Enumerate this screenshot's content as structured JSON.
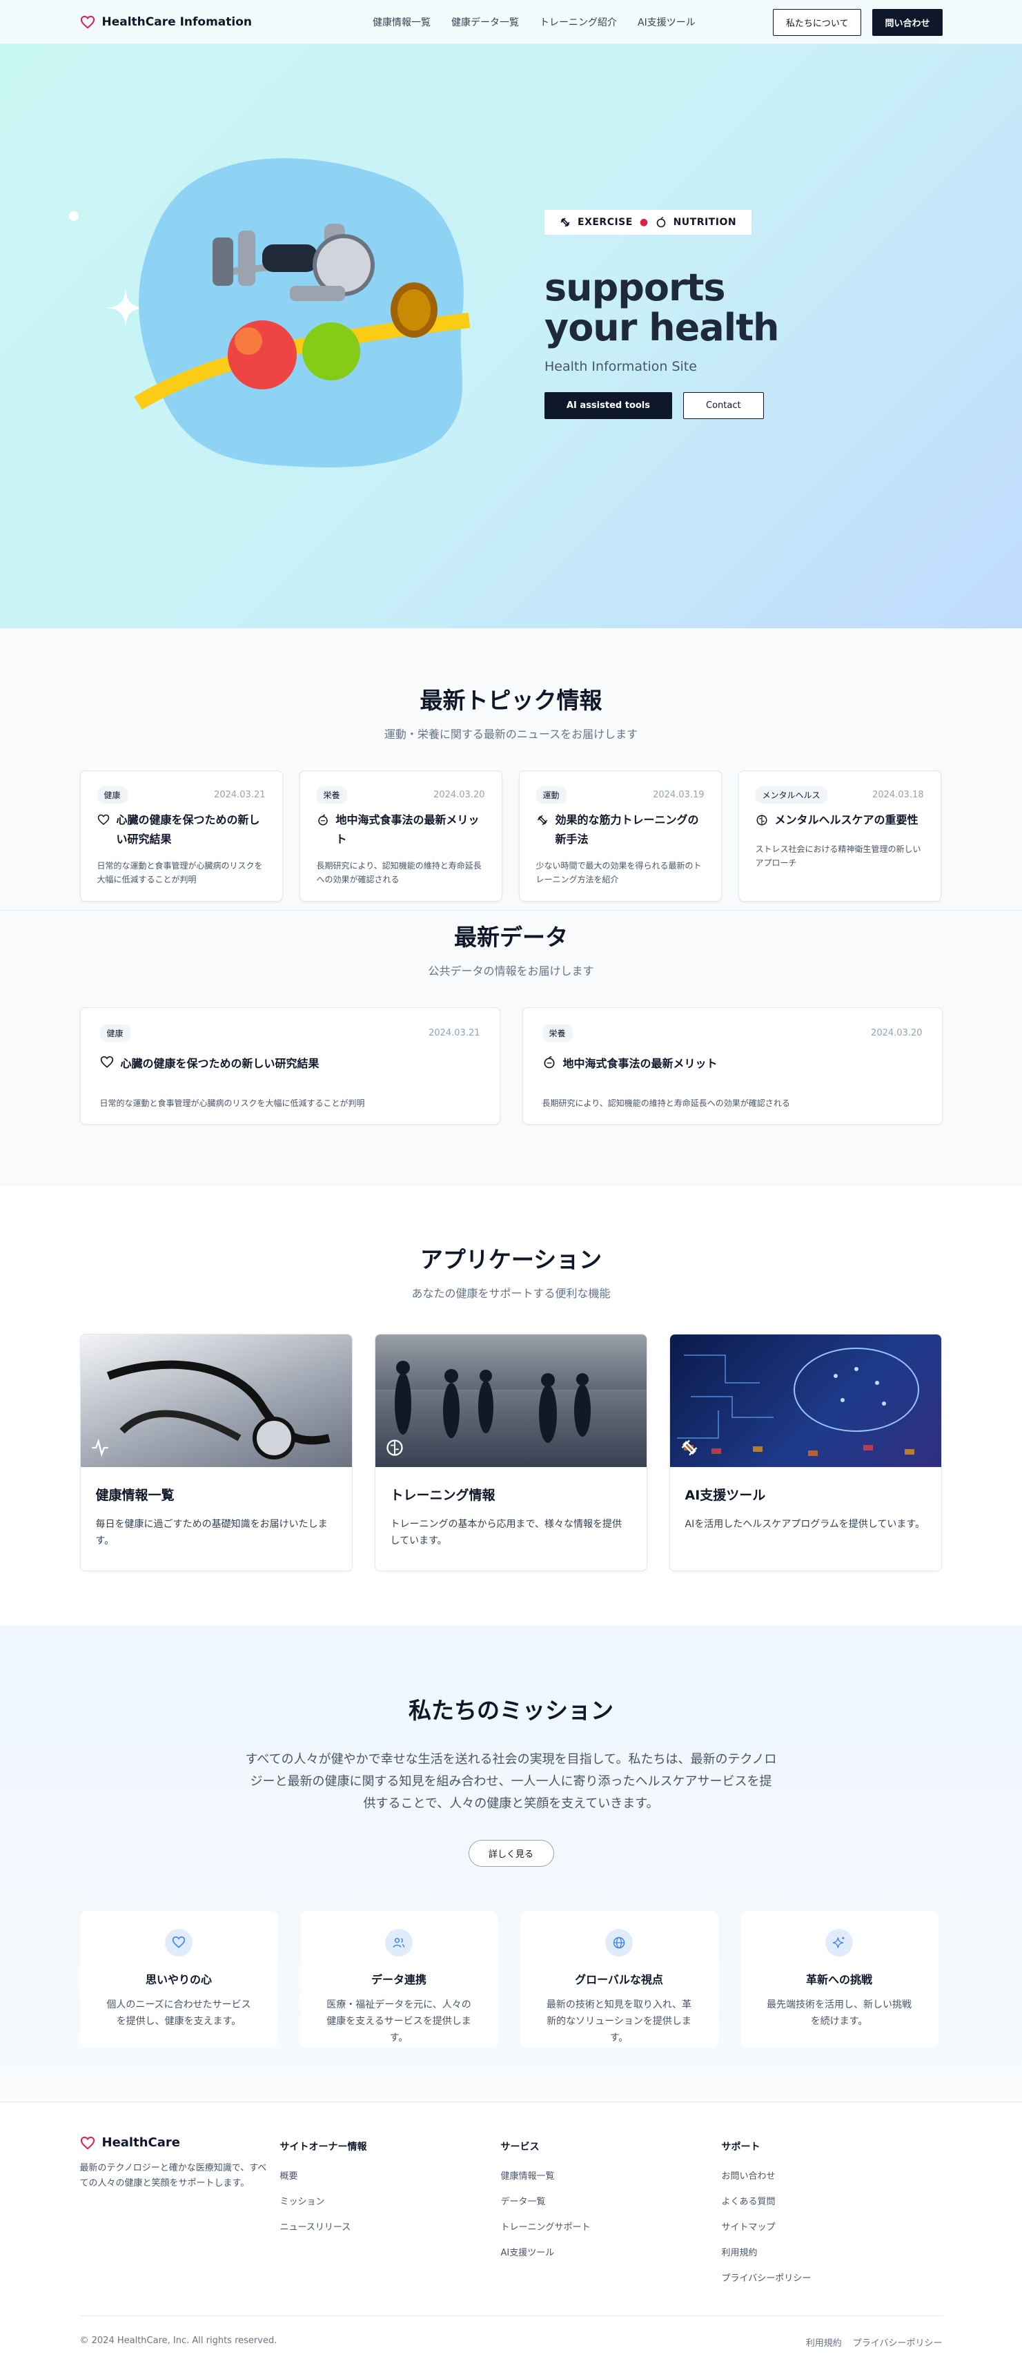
{
  "header": {
    "brand": "HealthCare Infomation",
    "nav": [
      "健康情報一覧",
      "健康データ一覧",
      "トレーニング紹介",
      "AI支援ツール"
    ],
    "about_btn": "私たちについて",
    "contact_btn": "問い合わせ"
  },
  "hero": {
    "tag_left": "EXERCISE",
    "tag_right": "NUTRITION",
    "title_line1": "supports",
    "title_line2": "your health",
    "subtitle": "Health Information Site",
    "primary_btn": "AI assisted tools",
    "secondary_btn": "Contact"
  },
  "topics": {
    "title": "最新トピック情報",
    "subtitle": "運動・栄養に関する最新のニュースをお届けします",
    "cards": [
      {
        "badge": "健康",
        "date": "2024.03.21",
        "title": "心臓の健康を保つための新しい研究結果",
        "desc": "日常的な運動と食事管理が心臓病のリスクを大幅に低減することが判明",
        "icon": "heart-icon"
      },
      {
        "badge": "栄養",
        "date": "2024.03.20",
        "title": "地中海式食事法の最新メリット",
        "desc": "長期研究により、認知機能の維持と寿命延長への効果が確認される",
        "icon": "apple-icon"
      },
      {
        "badge": "運動",
        "date": "2024.03.19",
        "title": "効果的な筋力トレーニングの新手法",
        "desc": "少ない時間で最大の効果を得られる最新のトレーニング方法を紹介",
        "icon": "dumbbell-icon"
      },
      {
        "badge": "メンタルヘルス",
        "date": "2024.03.18",
        "title": "メンタルヘルスケアの重要性",
        "desc": "ストレス社会における精神衛生管理の新しいアプローチ",
        "icon": "brain-icon"
      }
    ]
  },
  "latest_data": {
    "title": "最新データ",
    "subtitle": "公共データの情報をお届けします",
    "cards": [
      {
        "badge": "健康",
        "date": "2024.03.21",
        "title": "心臓の健康を保つための新しい研究結果",
        "desc": "日常的な運動と食事管理が心臓病のリスクを大幅に低減することが判明",
        "icon": "heart-icon"
      },
      {
        "badge": "栄養",
        "date": "2024.03.20",
        "title": "地中海式食事法の最新メリット",
        "desc": "長期研究により、認知機能の維持と寿命延長への効果が確認される",
        "icon": "apple-icon"
      }
    ]
  },
  "apps": {
    "title": "アプリケーション",
    "subtitle": "あなたの健康をサポートする便利な機能",
    "cards": [
      {
        "title": "健康情報一覧",
        "desc": "毎日を健康に過ごすための基礎知識をお届けいたします。",
        "icon": "activity-icon"
      },
      {
        "title": "トレーニング情報",
        "desc": "トレーニングの基本から応用まで、様々な情報を提供しています。",
        "icon": "brain-icon"
      },
      {
        "title": "AI支援ツール",
        "desc": "AIを活用したヘルスケアプログラムを提供しています。",
        "icon": "dumbbell-icon"
      }
    ]
  },
  "mission": {
    "title": "私たちのミッション",
    "text": "すべての人々が健やかで幸せな生活を送れる社会の実現を目指して。私たちは、最新のテクノロジーと最新の健康に関する知見を組み合わせ、一人一人に寄り添ったヘルスケアサービスを提供することで、人々の健康と笑顔を支えていきます。",
    "more_btn": "詳しく見る",
    "values": [
      {
        "title": "思いやりの心",
        "desc": "個人のニーズに合わせたサービスを提供し、健康を支えます。",
        "icon": "heart-icon"
      },
      {
        "title": "データ連携",
        "desc": "医療・福祉データを元に、人々の健康を支えるサービスを提供します。",
        "icon": "users-icon"
      },
      {
        "title": "グローバルな視点",
        "desc": "最新の技術と知見を取り入れ、革新的なソリューションを提供します。",
        "icon": "globe-icon"
      },
      {
        "title": "革新への挑戦",
        "desc": "最先端技術を活用し、新しい挑戦を続けます。",
        "icon": "sparkles-icon"
      }
    ]
  },
  "footer": {
    "brand": "HealthCare",
    "desc": "最新のテクノロジーと確かな医療知識で、すべての人々の健康と笑顔をサポートします。",
    "columns": [
      {
        "heading": "サイトオーナー情報",
        "links": [
          "概要",
          "ミッション",
          "ニュースリリース"
        ]
      },
      {
        "heading": "サービス",
        "links": [
          "健康情報一覧",
          "データ一覧",
          "トレーニングサポート",
          "AI支援ツール"
        ]
      },
      {
        "heading": "サポート",
        "links": [
          "お問い合わせ",
          "よくある質問",
          "サイトマップ",
          "利用規約",
          "プライバシーポリシー"
        ]
      }
    ],
    "copyright": "© 2024 HealthCare, Inc. All rights reserved.",
    "legal": [
      "利用規約",
      "プライバシーポリシー"
    ]
  },
  "colors": {
    "accent": "#0f172a",
    "heart": "#e11d48",
    "blob": "#8fd3f4",
    "value_icon": "#3b82f6"
  }
}
